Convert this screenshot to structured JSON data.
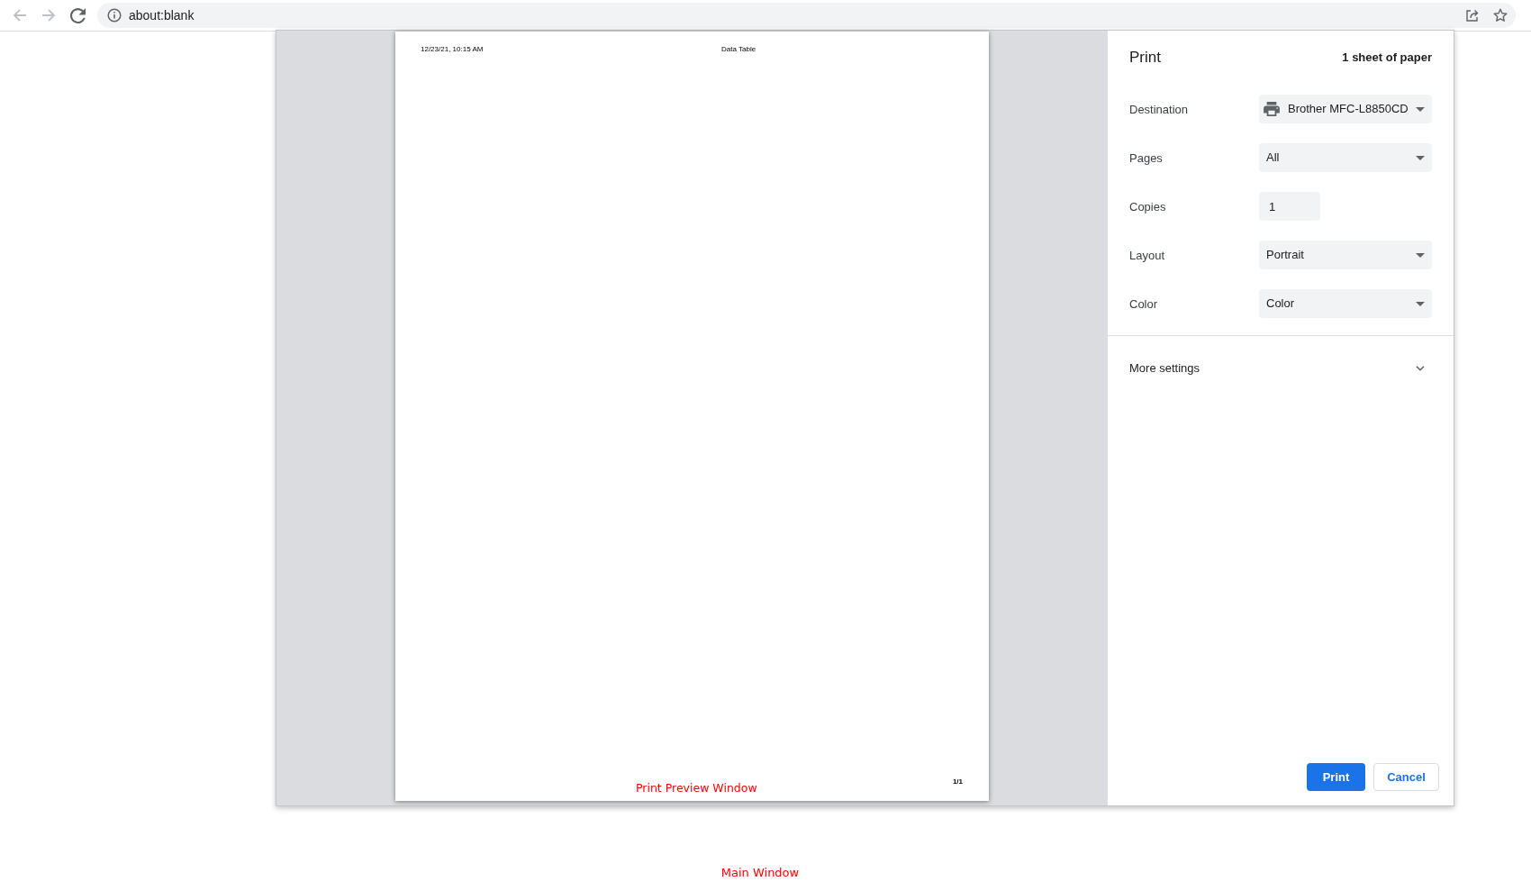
{
  "browser": {
    "nav_buttons": [
      {
        "kind": "back",
        "disabled": true
      },
      {
        "kind": "forward",
        "disabled": true
      },
      {
        "kind": "reload",
        "disabled": false
      }
    ],
    "address": "about:blank"
  },
  "print_dialog": {
    "preview": {
      "page": {
        "header_left": "12/23/21, 10:15 AM",
        "header_center": "Data Table",
        "page_number": "1/1"
      },
      "annotation": "Print Preview Window"
    },
    "settings": {
      "title": "Print",
      "sheet_count": "1 sheet of paper",
      "fields": [
        {
          "label": "Destination",
          "kind": "printer_select",
          "value": "Brother MFC-L8850CD"
        },
        {
          "label": "Pages",
          "kind": "select",
          "value": "All"
        },
        {
          "label": "Copies",
          "kind": "number",
          "value": "1"
        },
        {
          "label": "Layout",
          "kind": "select",
          "value": "Portrait"
        },
        {
          "label": "Color",
          "kind": "select",
          "value": "Color"
        }
      ],
      "more_settings": {
        "label": "More settings",
        "expanded": false
      },
      "buttons": [
        {
          "label": "Print",
          "kind": "primary"
        },
        {
          "label": "Cancel",
          "kind": "secondary"
        }
      ]
    }
  },
  "main_window": {
    "annotation": "Main Window"
  }
}
